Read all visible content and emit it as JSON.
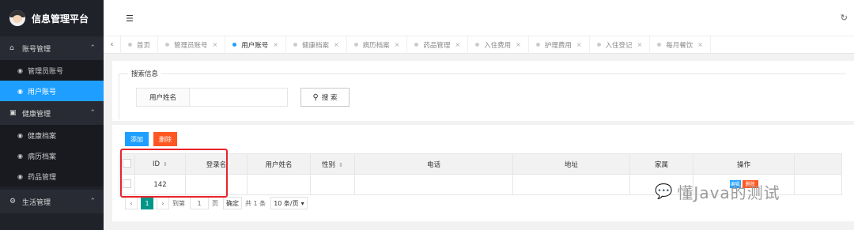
{
  "sidebar": {
    "brand": "信息管理平台",
    "groups": [
      {
        "label": "账号管理",
        "items": [
          {
            "label": "管理员账号"
          },
          {
            "label": "用户账号"
          }
        ]
      },
      {
        "label": "健康管理",
        "items": [
          {
            "label": "健康档案"
          },
          {
            "label": "病历档案"
          },
          {
            "label": "药品管理"
          }
        ]
      },
      {
        "label": "生活管理",
        "items": []
      }
    ]
  },
  "tabs": [
    {
      "label": "首页"
    },
    {
      "label": "管理员账号"
    },
    {
      "label": "用户账号"
    },
    {
      "label": "健康档案"
    },
    {
      "label": "病历档案"
    },
    {
      "label": "药品管理"
    },
    {
      "label": "入住费用"
    },
    {
      "label": "护理费用"
    },
    {
      "label": "入住登记"
    },
    {
      "label": "每月餐饮"
    }
  ],
  "search": {
    "legend": "搜索信息",
    "field_label": "用户姓名",
    "value": "",
    "button": "搜 索"
  },
  "toolbar": {
    "add": "添加",
    "delete": "删除"
  },
  "table": {
    "headers": [
      "ID",
      "登录名",
      "用户姓名",
      "性别",
      "电话",
      "地址",
      "家属",
      "操作"
    ],
    "rows": [
      {
        "id": "142",
        "login": "",
        "name": "",
        "gender": "",
        "phone": "",
        "address": "",
        "family": "",
        "edit": "编辑",
        "del": "删除"
      }
    ]
  },
  "pagination": {
    "current": "1",
    "goto_label": "到第",
    "goto_value": "1",
    "page_unit": "页",
    "confirm": "确定",
    "total": "共 1 条",
    "page_size": "10 条/页"
  },
  "watermark": "懂Java的测试",
  "colors": {
    "primary": "#1e9fff",
    "danger": "#ff5722",
    "page_current": "#009688",
    "highlight": "#e8242b",
    "sidebar_bg": "#20222a"
  }
}
